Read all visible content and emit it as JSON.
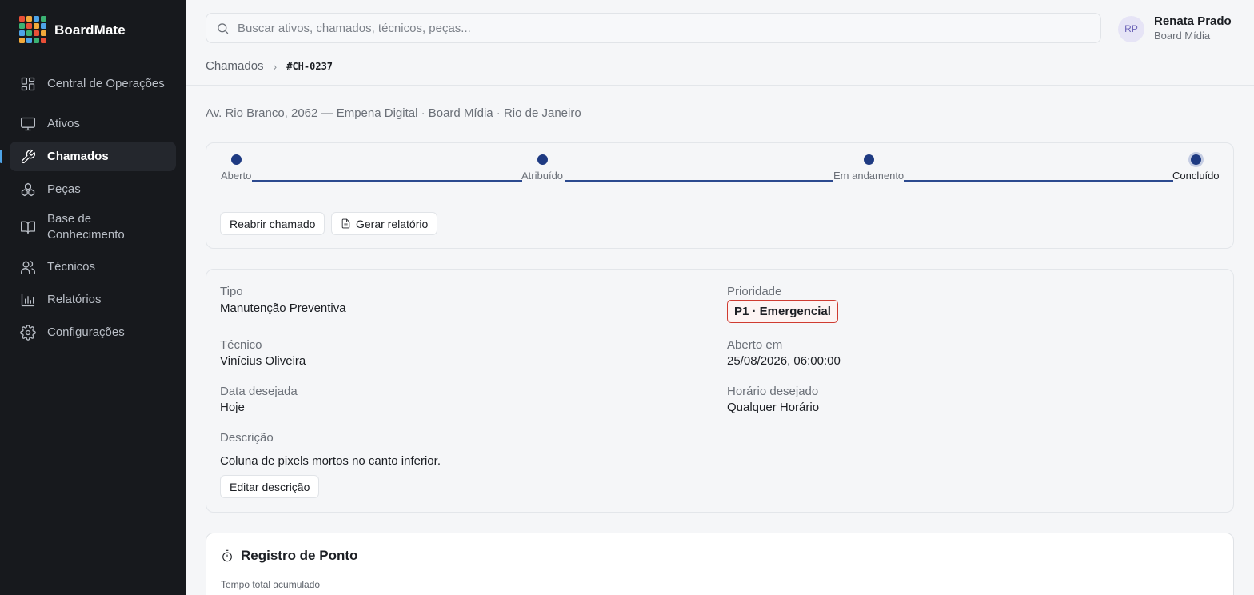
{
  "brand": {
    "name": "BoardMate",
    "logo_colors": [
      "#e94f37",
      "#f2a93b",
      "#4ea4e8",
      "#3bb273",
      "#3bb273",
      "#e94f37",
      "#f2a93b",
      "#4ea4e8",
      "#4ea4e8",
      "#3bb273",
      "#e94f37",
      "#f2a93b",
      "#f2a93b",
      "#4ea4e8",
      "#3bb273",
      "#e94f37"
    ]
  },
  "sidebar": {
    "items": [
      {
        "label": "Central de Operações",
        "icon": "grid-icon"
      },
      {
        "label": "Ativos",
        "icon": "monitor-icon"
      },
      {
        "label": "Chamados",
        "icon": "wrench-icon",
        "active": true
      },
      {
        "label": "Peças",
        "icon": "boxes-icon"
      },
      {
        "label": "Base de Conhecimento",
        "icon": "book-icon"
      },
      {
        "label": "Técnicos",
        "icon": "users-icon"
      },
      {
        "label": "Relatórios",
        "icon": "chart-icon"
      },
      {
        "label": "Configurações",
        "icon": "gear-icon"
      }
    ]
  },
  "search": {
    "placeholder": "Buscar ativos, chamados, técnicos, peças...",
    "value": ""
  },
  "user": {
    "initials": "RP",
    "name": "Renata Prado",
    "org": "Board Mídia"
  },
  "breadcrumb": {
    "parent": "Chamados",
    "current": "#CH-0237"
  },
  "ticket": {
    "address": "Av. Rio Branco, 2062 — Empena Digital · Board Mídia · Rio de Janeiro",
    "steps": [
      "Aberto",
      "Atribuído",
      "Em andamento",
      "Concluído"
    ],
    "current_step": 4,
    "actions": {
      "reopen": "Reabrir chamado",
      "report": "Gerar relatório"
    }
  },
  "details": {
    "tipo_label": "Tipo",
    "tipo_value": "Manutenção Preventiva",
    "prioridade_label": "Prioridade",
    "prioridade_value": "P1 · Emergencial",
    "tecnico_label": "Técnico",
    "tecnico_value": "Vinícius Oliveira",
    "aberto_label": "Aberto em",
    "aberto_value": "25/08/2026, 06:00:00",
    "data_label": "Data desejada",
    "data_value": "Hoje",
    "horario_label": "Horário desejado",
    "horario_value": "Qualquer Horário",
    "descricao_label": "Descrição",
    "descricao_value": "Coluna de pixels mortos no canto inferior.",
    "edit_label": "Editar descrição",
    "priority_color": "#cf3b31"
  },
  "ponto": {
    "title": "Registro de Ponto",
    "total_label": "Tempo total acumulado"
  }
}
